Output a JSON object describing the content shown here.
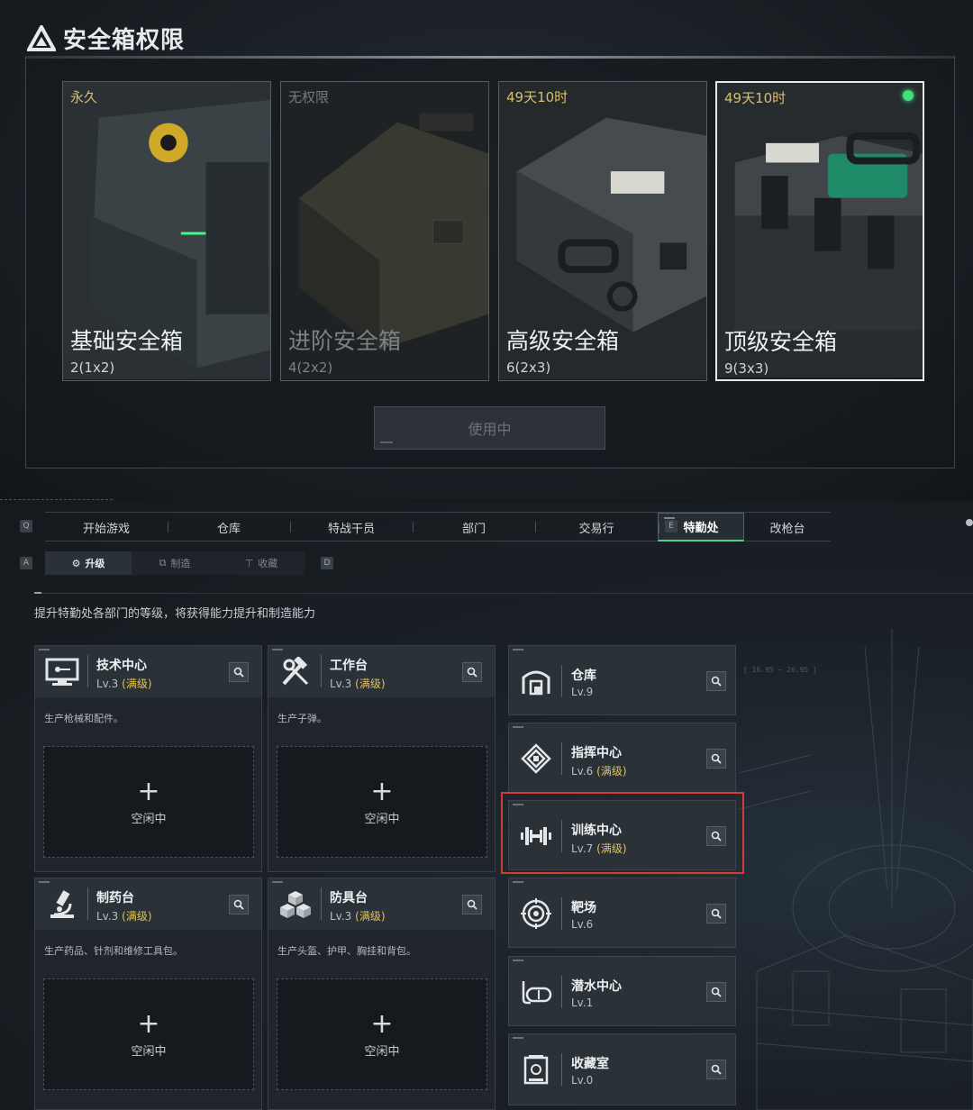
{
  "header": {
    "title": "安全箱权限"
  },
  "cases": [
    {
      "duration": "永久",
      "name": "基础安全箱",
      "size": "2(1x2)",
      "locked": false,
      "selected": false
    },
    {
      "duration": "无权限",
      "name": "进阶安全箱",
      "size": "4(2x2)",
      "locked": true,
      "selected": false
    },
    {
      "duration": "49天10时",
      "name": "高级安全箱",
      "size": "6(2x3)",
      "locked": false,
      "selected": false
    },
    {
      "duration": "49天10时",
      "name": "顶级安全箱",
      "size": "9(3x3)",
      "locked": false,
      "selected": true,
      "active_indicator": true
    }
  ],
  "in_use_button": "使用中",
  "key_hints": {
    "left_main": "Q",
    "right_main": "E",
    "left_sub": "A",
    "right_sub": "D"
  },
  "main_tabs": [
    {
      "label": "开始游戏"
    },
    {
      "label": "仓库"
    },
    {
      "label": "特战干员"
    },
    {
      "label": "部门"
    },
    {
      "label": "交易行"
    },
    {
      "label": "特勤处",
      "active": true
    },
    {
      "label": "改枪台"
    }
  ],
  "sub_tabs": [
    {
      "label": "升级",
      "icon": "gear-upgrade-icon",
      "active": true
    },
    {
      "label": "制造",
      "icon": "craft-icon"
    },
    {
      "label": "收藏",
      "icon": "collection-icon"
    }
  ],
  "description": "提升特勤处各部门的等级，将获得能力提升和制造能力",
  "production_departments": [
    {
      "name": "技术中心",
      "level": "Lv.3",
      "max": "(满级)",
      "desc": "生产枪械和配件。",
      "slot": "空闲中",
      "icon": "computer-icon"
    },
    {
      "name": "工作台",
      "level": "Lv.3",
      "max": "(满级)",
      "desc": "生产子弹。",
      "slot": "空闲中",
      "icon": "tools-icon"
    },
    {
      "name": "制药台",
      "level": "Lv.3",
      "max": "(满级)",
      "desc": "生产药品、针剂和维修工具包。",
      "slot": "空闲中",
      "icon": "microscope-icon"
    },
    {
      "name": "防具台",
      "level": "Lv.3",
      "max": "(满级)",
      "desc": "生产头盔、护甲、胸挂和背包。",
      "slot": "空闲中",
      "icon": "armor-boxes-icon"
    }
  ],
  "side_departments": [
    {
      "name": "仓库",
      "level": "Lv.9",
      "max": "",
      "icon": "warehouse-icon"
    },
    {
      "name": "指挥中心",
      "level": "Lv.6",
      "max": "(满级)",
      "icon": "command-icon"
    },
    {
      "name": "训练中心",
      "level": "Lv.7",
      "max": "(满级)",
      "icon": "dumbbell-icon",
      "highlighted": true
    },
    {
      "name": "靶场",
      "level": "Lv.6",
      "max": "",
      "icon": "target-icon"
    },
    {
      "name": "潜水中心",
      "level": "Lv.1",
      "max": "",
      "icon": "diving-mask-icon"
    },
    {
      "name": "收藏室",
      "level": "Lv.0",
      "max": "",
      "icon": "collection-room-icon"
    }
  ],
  "colors": {
    "accent_green": "#4fd38a",
    "max_gold": "#e0c25a",
    "highlight_red": "#d43b33",
    "duration_gold": "#d7bf6e"
  }
}
